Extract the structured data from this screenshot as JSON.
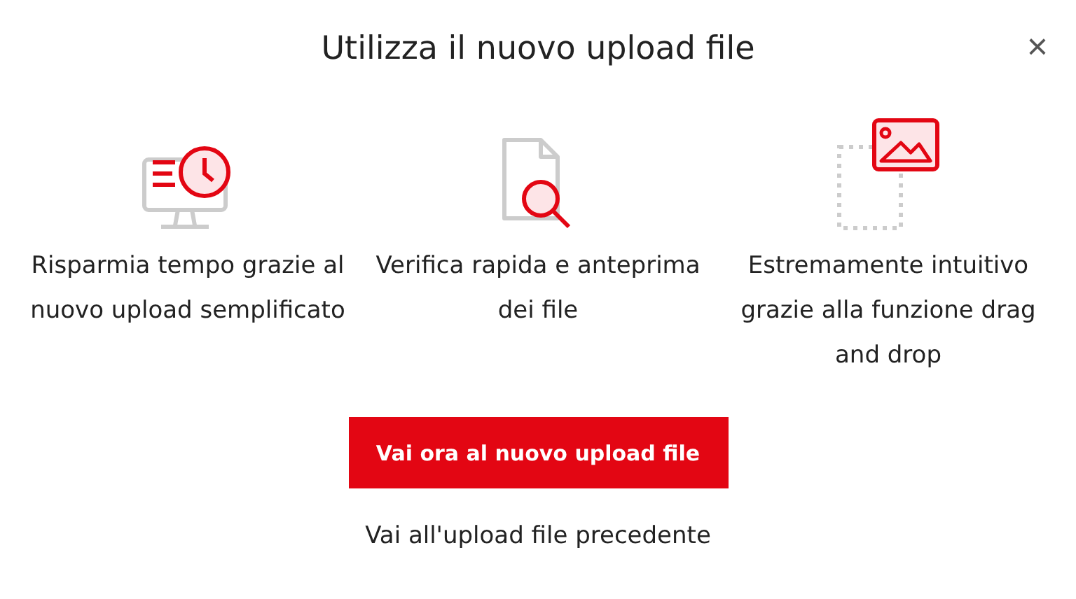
{
  "dialog": {
    "title": "Utilizza il nuovo upload file",
    "close": "×"
  },
  "features": [
    {
      "kind": "monitor-clock",
      "text": "Risparmia tempo grazie al nuovo upload semplificato"
    },
    {
      "kind": "file-search",
      "text": "Verifica rapida e anteprima dei file"
    },
    {
      "kind": "image-drag",
      "text": "Estremamente intuitivo grazie alla funzione drag and drop"
    }
  ],
  "primary_button": "Vai ora al nuovo upload file",
  "secondary_link": "Vai all'upload file precedente"
}
